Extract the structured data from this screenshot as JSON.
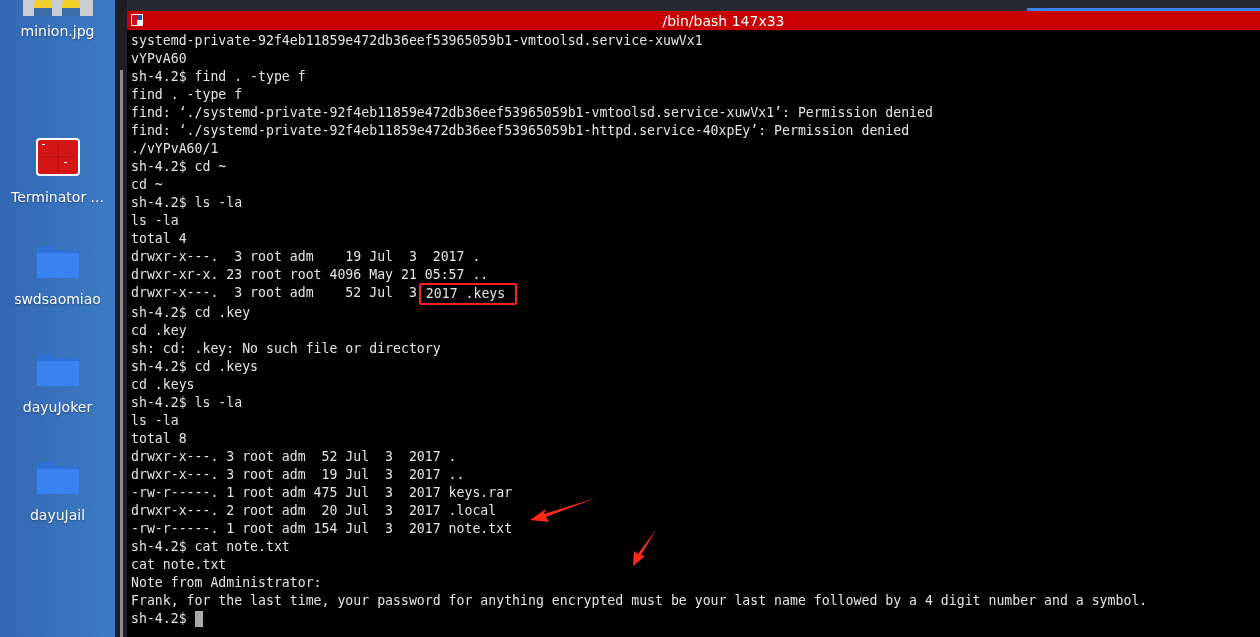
{
  "desktop_icons": [
    {
      "kind": "picture",
      "label": "minion.jpg"
    },
    {
      "kind": "terminal",
      "label": "Terminator ..."
    },
    {
      "kind": "folder",
      "label": "swdsaomiao"
    },
    {
      "kind": "folder",
      "label": "dayuJoker"
    },
    {
      "kind": "folder",
      "label": "dayuJail"
    }
  ],
  "terminal": {
    "title": "/bin/bash 147x33",
    "lines": [
      "systemd-private-92f4eb11859e472db36eef53965059b1-vmtoolsd.service-xuwVx1",
      "vYPvA60",
      "sh-4.2$ find . -type f",
      "find . -type f",
      "find: ‘./systemd-private-92f4eb11859e472db36eef53965059b1-vmtoolsd.service-xuwVx1’: Permission denied",
      "find: ‘./systemd-private-92f4eb11859e472db36eef53965059b1-httpd.service-40xpEy’: Permission denied",
      "./vYPvA60/1",
      "sh-4.2$ cd ~",
      "cd ~",
      "sh-4.2$ ls -la",
      "ls -la",
      "total 4",
      "drwxr-x---.  3 root adm    19 Jul  3  2017 .",
      "drwxr-xr-x. 23 root root 4096 May 21 05:57 ..",
      {
        "text": "drwxr-x---.  3 root adm    52 Jul  3",
        "boxed": "2017 .keys"
      },
      "sh-4.2$ cd .key",
      "cd .key",
      "sh: cd: .key: No such file or directory",
      "sh-4.2$ cd .keys",
      "cd .keys",
      "sh-4.2$ ls -la",
      "ls -la",
      "total 8",
      "drwxr-x---. 3 root adm  52 Jul  3  2017 .",
      "drwxr-x---. 3 root adm  19 Jul  3  2017 ..",
      "-rw-r-----. 1 root adm 475 Jul  3  2017 keys.rar",
      "drwxr-x---. 2 root adm  20 Jul  3  2017 .local",
      "-rw-r-----. 1 root adm 154 Jul  3  2017 note.txt",
      "sh-4.2$ cat note.txt",
      "cat note.txt",
      "Note from Administrator:",
      "Frank, for the last time, your password for anything encrypted must be your last name followed by a 4 digit number and a symbol."
    ],
    "prompt": "sh-4.2$ "
  }
}
